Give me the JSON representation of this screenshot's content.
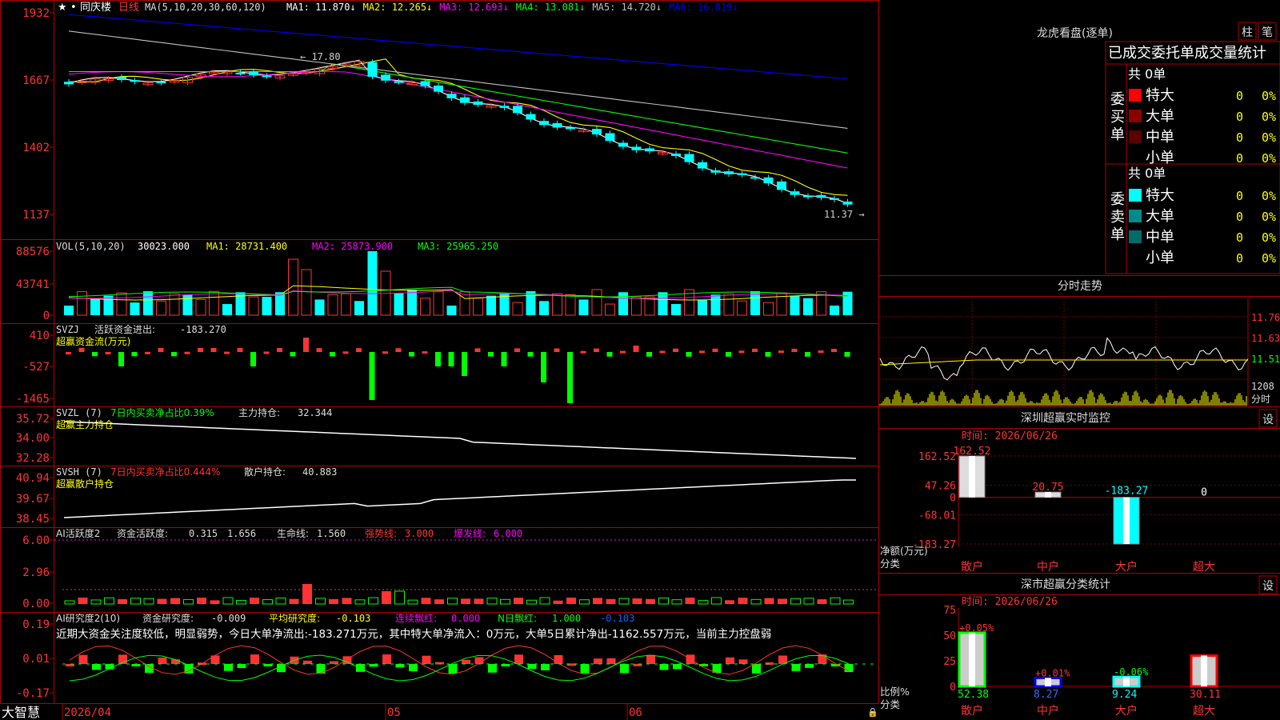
{
  "app": {
    "name": "大智慧"
  },
  "kline": {
    "stock_name": "同庆楼",
    "period": "日线",
    "ma_def": "MA(5,10,20,30,60,120)",
    "ma": [
      {
        "label": "MA1:",
        "value": "11.870",
        "color": "#ffffff"
      },
      {
        "label": "MA2:",
        "value": "12.265",
        "color": "#ffff00"
      },
      {
        "label": "MA3:",
        "value": "12.693",
        "color": "#ff00ff"
      },
      {
        "label": "MA4:",
        "value": "13.081",
        "color": "#00ff00"
      },
      {
        "label": "MA5:",
        "value": "14.720",
        "color": "#c0c0c0"
      },
      {
        "label": "MA6:",
        "value": "16.819",
        "color": "#0000ff"
      }
    ],
    "y_ticks": [
      "1932",
      "1667",
      "1402",
      "1137"
    ],
    "high_label": "17.80",
    "low_label": "11.37"
  },
  "vol": {
    "title": "VOL(5,10,20)",
    "value": "30023.000",
    "ma1": "MA1: 28731.400",
    "ma2": "MA2: 25873.900",
    "ma3": "MA3: 25965.250",
    "y_ticks": [
      "88576",
      "43741",
      "0"
    ]
  },
  "svzj": {
    "title": "SVZJ",
    "label": "活跃资金进出:",
    "value": "-183.270",
    "sub": "超赢资金流(万元)",
    "y_ticks": [
      "410",
      "-527",
      "-1465"
    ]
  },
  "svzl": {
    "title": "SVZL (7)",
    "ratio": "7日内买卖净占比0.39%",
    "label": "主力持仓:",
    "value": "32.344",
    "sub": "超赢主力持仓",
    "y_ticks": [
      "35.72",
      "34.00",
      "32.28"
    ]
  },
  "svsh": {
    "title": "SVSH (7)",
    "ratio": "7日内买卖净占比0.444%",
    "label": "散户持仓:",
    "value": "40.883",
    "sub": "超赢散户持仓",
    "y_ticks": [
      "40.94",
      "39.67",
      "38.45"
    ]
  },
  "ai1": {
    "title": "AI活跃度2",
    "l1": "资金活跃度:",
    "v1": "0.315",
    "v2": "1.656",
    "l3": "生命线:",
    "v3": "1.560",
    "l4": "强势线:",
    "v4": "3.000",
    "l5": "爆发线:",
    "v5": "6.000",
    "y_ticks": [
      "6.00",
      "2.96",
      "0.00"
    ]
  },
  "ai2": {
    "title": "AI研究度2(10)",
    "l1": "资金研究度:",
    "v1": "-0.009",
    "l2": "平均研究度:",
    "v2": "-0.103",
    "l3": "连续飘红:",
    "v3": "0.000",
    "l4": "N日飘红:",
    "v4": "1.000",
    "v5": "-0.103",
    "commentary": "近期大资金关注度较低，明显弱势，今日大单净流出:-183.271万元，其中特大单净流入：0万元，大单5日累计净出-1162.557万元，当前主力控盘弱",
    "y_ticks": [
      "0.19",
      "0.01",
      "-0.17"
    ]
  },
  "x_axis": {
    "labels": [
      "2026/04",
      "05",
      "06"
    ]
  },
  "dragon": {
    "title": "龙虎看盘(逐单)",
    "btn1": "柱",
    "btn2": "笔",
    "subtitle": "已成交委托单成交量统计",
    "buy_label": "委买单",
    "sell_label": "委卖单",
    "buy_total": "共 0单",
    "sell_total": "共 0单",
    "buy_rows": [
      {
        "name": "特大",
        "count": "0",
        "pct": "0%",
        "color": "#ff0000"
      },
      {
        "name": "大单",
        "count": "0",
        "pct": "0%",
        "color": "#8b0000"
      },
      {
        "name": "中单",
        "count": "0",
        "pct": "0%",
        "color": "#5a0000"
      },
      {
        "name": "小单",
        "count": "0",
        "pct": "0%",
        "color": ""
      }
    ],
    "sell_rows": [
      {
        "name": "特大",
        "count": "0",
        "pct": "0%",
        "color": "#00ffff"
      },
      {
        "name": "大单",
        "count": "0",
        "pct": "0%",
        "color": "#008b8b"
      },
      {
        "name": "中单",
        "count": "0",
        "pct": "0%",
        "color": "#006b6b"
      },
      {
        "name": "小单",
        "count": "0",
        "pct": "0%",
        "color": ""
      }
    ]
  },
  "intraday": {
    "title": "分时走势",
    "y_ticks": [
      "11.76",
      "11.63",
      "11.51"
    ],
    "vol_tick": "1208",
    "vol_label": "分时"
  },
  "sz_monitor": {
    "title": "深圳超赢实时监控",
    "btn": "设",
    "time_label": "时间: 2026/06/26",
    "y_ticks": [
      "162.52",
      "47.26",
      "0",
      "-68.01",
      "-183.27"
    ],
    "footer1": "净额(万元)",
    "footer2": "分类",
    "categories": [
      "散户",
      "中户",
      "大户",
      "超大"
    ],
    "values": [
      162.52,
      20.75,
      -183.27,
      0
    ],
    "value_labels": [
      "162.52",
      "20.75",
      "-183.27",
      "0"
    ]
  },
  "sz_class": {
    "title": "深市超赢分类统计",
    "btn": "设",
    "time_label": "时间: 2026/06/26",
    "y_ticks": [
      "75",
      "50",
      "25",
      "0"
    ],
    "footer1": "比例%",
    "footer2": "分类",
    "categories": [
      "散户",
      "中户",
      "大户",
      "超大"
    ],
    "values": [
      52.38,
      8.27,
      9.24,
      30.11
    ],
    "value_labels": [
      "52.38",
      "8.27",
      "9.24",
      "30.11"
    ],
    "changes": [
      "+0.05%",
      "+0.01%",
      "-0.06%",
      ""
    ]
  },
  "chart_data": [
    {
      "type": "bar",
      "title": "深圳超赢实时监控",
      "ylabel": "净额(万元)",
      "categories": [
        "散户",
        "中户",
        "大户",
        "超大"
      ],
      "values": [
        162.52,
        20.75,
        -183.27,
        0
      ],
      "ylim": [
        -183.27,
        162.52
      ]
    },
    {
      "type": "bar",
      "title": "深市超赢分类统计",
      "ylabel": "比例%",
      "categories": [
        "散户",
        "中户",
        "大户",
        "超大"
      ],
      "values": [
        52.38,
        8.27,
        9.24,
        30.11
      ],
      "ylim": [
        0,
        75
      ]
    },
    {
      "type": "line",
      "title": "",
      "series": [
        {
          "name": "MA1",
          "values": [
            11.87
          ]
        },
        {
          "name": "MA2",
          "values": [
            12.265
          ]
        },
        {
          "name": "MA3",
          "values": [
            12.693
          ]
        },
        {
          "name": "MA4",
          "values": [
            13.081
          ]
        },
        {
          "name": "MA5",
          "values": [
            14.72
          ]
        },
        {
          "name": "MA6",
          "values": [
            16.819
          ]
        }
      ]
    }
  ]
}
